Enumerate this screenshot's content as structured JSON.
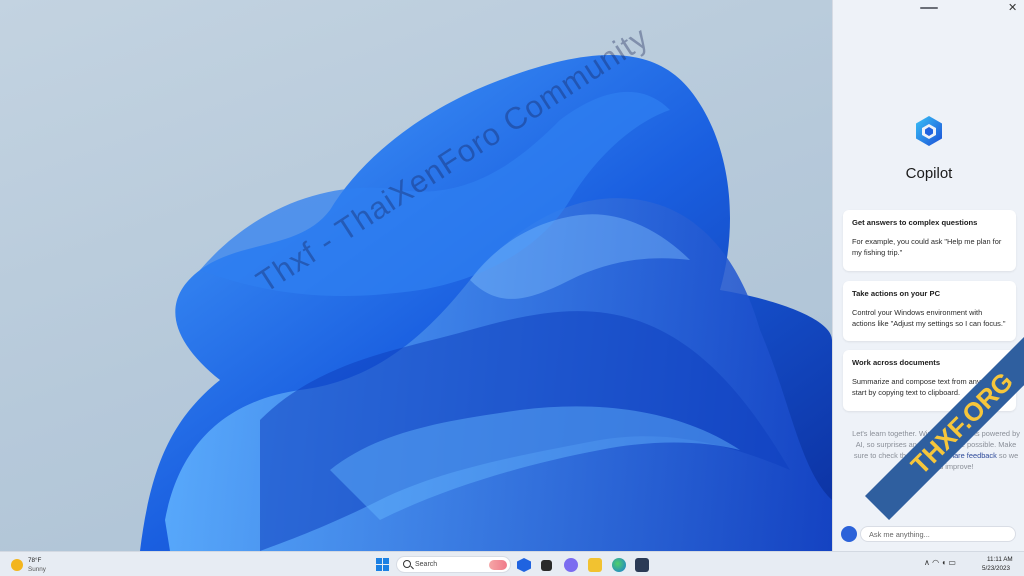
{
  "panel": {
    "title": "Copilot",
    "close_label": "✕",
    "cards": [
      {
        "heading": "Get answers to complex questions",
        "body": "For example, you could ask \"Help me plan for my fishing trip.\""
      },
      {
        "heading": "Take actions on your PC",
        "body": "Control your Windows environment with actions like \"Adjust my settings so I can focus.\""
      },
      {
        "heading": "Work across documents",
        "body": "Summarize and compose text from any app - start by copying text to clipboard."
      }
    ],
    "disclaimer_text": "Let's learn together. Windows copilot is powered by AI, so surprises and mistakes are possible. Make sure to check the facts, and",
    "disclaimer_link": "share feedback",
    "disclaimer_tail": "so we can learn and improve!",
    "input_placeholder": "Ask me anything..."
  },
  "watermark": "Thxf - ThaiXenForo Community",
  "badge": "THXF.ORG",
  "taskbar": {
    "weather_temp": "78°F",
    "weather_desc": "Sunny",
    "search_label": "Search",
    "tray_icons": "∧  ◠ ◖ ▭",
    "clock_time": "11:11 AM",
    "clock_date": "5/23/2023"
  },
  "colors": {
    "accent": "#2b62d9",
    "wallpaper_blue": "#1a5fe0",
    "panel_bg": "#eef2f8"
  }
}
